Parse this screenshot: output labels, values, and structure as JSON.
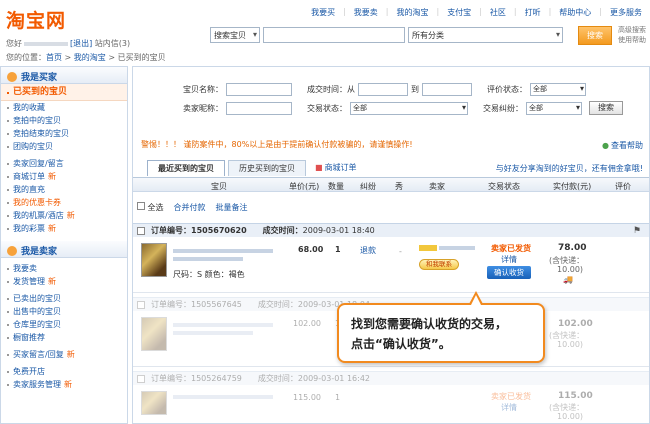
{
  "logo": "淘宝网",
  "topnav": [
    "我要买",
    "我要卖",
    "我的淘宝",
    "支付宝",
    "社区",
    "打听",
    "帮助中心",
    "更多服务"
  ],
  "user": {
    "hello": "您好",
    "logout": "[退出]",
    "messages": "站内信(3)"
  },
  "breadcrumb": {
    "prefix": "您的位置：",
    "home": "首页",
    "mytaobao": "我的淘宝",
    "current": "已买到的宝贝"
  },
  "search": {
    "type": "搜索宝贝",
    "category": "所有分类",
    "button": "搜索",
    "advanced": "高级搜索 使用帮助"
  },
  "sidebar": {
    "buyer_title": "我是买家",
    "buyer_items": [
      {
        "label": "已买到的宝贝",
        "new": ""
      },
      {
        "label": "我的收藏",
        "new": ""
      },
      {
        "label": "竞拍中的宝贝",
        "new": ""
      },
      {
        "label": "竞拍结束的宝贝",
        "new": ""
      },
      {
        "label": "团购的宝贝",
        "new": ""
      },
      {
        "label": "卖家回复/留言",
        "new": ""
      },
      {
        "label": "商城订单",
        "new": "新"
      },
      {
        "label": "我的直充",
        "new": ""
      },
      {
        "label": "我的优惠卡券",
        "new": ""
      },
      {
        "label": "我的机票/酒店",
        "new": "新"
      },
      {
        "label": "我的彩票",
        "new": "新"
      }
    ],
    "seller_title": "我是卖家",
    "seller_items": [
      {
        "label": "我要卖",
        "new": ""
      },
      {
        "label": "发货管理",
        "new": "新"
      },
      {
        "label": "已卖出的宝贝",
        "new": ""
      },
      {
        "label": "出售中的宝贝",
        "new": ""
      },
      {
        "label": "仓库里的宝贝",
        "new": ""
      },
      {
        "label": "橱窗推荐",
        "new": ""
      },
      {
        "label": "买家留言/回复",
        "new": "新"
      },
      {
        "label": "免费开店",
        "new": ""
      },
      {
        "label": "卖家服务管理",
        "new": "新"
      }
    ]
  },
  "filters": {
    "item_name": "宝贝名称：",
    "deal_time": "成交时间：从",
    "to": "到",
    "rating_status": "评价状态：",
    "rating_value": "全部",
    "seller_nick": "卖家昵称：",
    "trade_status": "交易状态：",
    "trade_value": "全部",
    "dispute": "交易纠纷：",
    "dispute_value": "全部",
    "search_btn": "搜索"
  },
  "warning": "警惕！！！ 谨防案件中，80%以上是由于提前确认付款被骗的，请谨慎操作!",
  "help": "查看帮助",
  "tabs": {
    "recent": "最近买到的宝贝",
    "history": "历史买到的宝贝",
    "mall": "商城订单"
  },
  "promo": "与好友分享淘到的好宝贝，还有佣金拿哦!",
  "columns": [
    "宝贝",
    "单价(元)",
    "数量",
    "纠纷",
    "秀",
    "卖家",
    "交易状态",
    "实付款(元)",
    "评价"
  ],
  "bulk": {
    "select_all": "全选",
    "merge_pay": "合并付款",
    "batch_note": "批量备注"
  },
  "orders": [
    {
      "order_label": "订单编号：",
      "order_no": "1505670620",
      "time_label": "成交时间：",
      "time": "2009-03-01 18:40",
      "price": "68.00",
      "qty": "1",
      "refund": "退款",
      "spec": "尺码：S    颜色：褐色",
      "status": "卖家已发货",
      "detail": "详情",
      "confirm": "确认收货",
      "total": "78.00",
      "shipping": "(含快递：",
      "shipping_fee": "10.00)",
      "contact": "和我联系"
    },
    {
      "order_label": "订单编号：",
      "order_no": "1505567645",
      "time_label": "成交时间：",
      "time": "2009-03-01 18:04",
      "price": "102.00",
      "qty": "1",
      "total": "102.00",
      "shipping": "(含快递：",
      "shipping_fee": "10.00)"
    },
    {
      "order_label": "订单编号：",
      "order_no": "1505264759",
      "time_label": "成交时间：",
      "time": "2009-03-01 16:42",
      "price": "115.00",
      "qty": "1",
      "status": "卖家已发货",
      "detail": "详情",
      "total": "115.00",
      "shipping": "(含快递：",
      "shipping_fee": "10.00)"
    }
  ],
  "callout": {
    "line1": "找到您需要确认收货的交易，",
    "line2": "点击“确认收货”。"
  }
}
